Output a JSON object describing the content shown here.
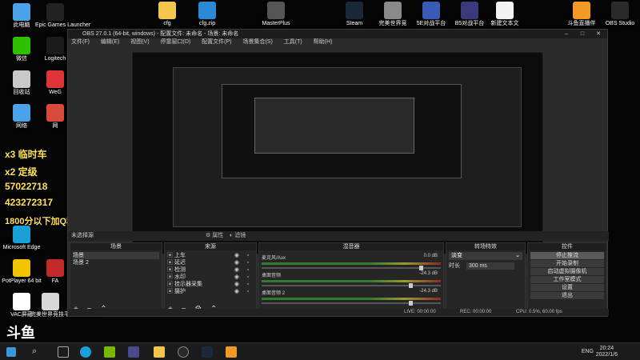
{
  "desktop": {
    "left_icons": [
      {
        "label": "此电脑",
        "icon": "computer-icon",
        "color": "#4aa3e8"
      },
      {
        "label": "Epic Games Launcher",
        "icon": "epic-icon",
        "color": "#222222"
      },
      {
        "label": "微信",
        "icon": "wechat-icon",
        "color": "#2dc100"
      },
      {
        "label": "Logitech",
        "icon": "logitech-icon",
        "color": "#1b1b1b"
      },
      {
        "label": "回收站",
        "icon": "recycle-bin-icon",
        "color": "#c9c9c9"
      },
      {
        "label": "WeG",
        "icon": "weg-icon",
        "color": "#e0343a"
      },
      {
        "label": "网络",
        "icon": "network-icon",
        "color": "#4aa3e8"
      },
      {
        "label": "网",
        "icon": "app-icon",
        "color": "#d94a3a"
      },
      {
        "label": "Microsoft Edge",
        "icon": "edge-icon",
        "color": "#1aa0d8"
      },
      {
        "label": "PotPlayer 64 bit",
        "icon": "potplayer-icon",
        "color": "#f2c300"
      },
      {
        "label": "FA",
        "icon": "fa-icon",
        "color": "#c02a2a"
      },
      {
        "label": "VAC屏蔽",
        "icon": "vac-icon",
        "color": "#ffffff"
      },
      {
        "label": "完美世界竞技平台",
        "icon": "perfect-world-icon",
        "color": "#d8d8d8"
      },
      {
        "label": "神器竞速模组",
        "icon": "mod-icon",
        "color": "#444444"
      }
    ],
    "top_icons": [
      {
        "label": "cfg",
        "icon": "folder-icon",
        "color": "#f4c64b"
      },
      {
        "label": "cfg.zip",
        "icon": "zip-icon",
        "color": "#2a8ad8"
      },
      {
        "label": "MasterPlus",
        "icon": "masterplus-icon",
        "color": "#555555"
      },
      {
        "label": "Steam",
        "icon": "steam-icon",
        "color": "#1b2838"
      },
      {
        "label": "完美世界竞",
        "icon": "perfect-icon",
        "color": "#8a8a8a"
      },
      {
        "label": "5E对战平台",
        "icon": "5e-icon",
        "color": "#3a5ab8"
      },
      {
        "label": "B5对战平台",
        "icon": "b5-icon",
        "color": "#3a3a7a"
      },
      {
        "label": "新建文本文",
        "icon": "text-file-icon",
        "color": "#f2f2f2"
      },
      {
        "label": "斗鱼直播伴",
        "icon": "douyu-icon",
        "color": "#f39a26"
      },
      {
        "label": "OBS Studio",
        "icon": "obs-icon",
        "color": "#2a2a2a"
      }
    ],
    "overlay_lines": [
      {
        "text": "x3 临时车"
      },
      {
        "text": "x2 定级"
      },
      {
        "text": "57022718"
      },
      {
        "text": "423272317"
      },
      {
        "text": "1800分以下加Q群有机会免费上分"
      }
    ],
    "watermark": "斗鱼"
  },
  "obs": {
    "title": "OBS 27.0.1 (64-bit, windows) - 配置文件: 未命名 - 场景: 未命名",
    "menu": [
      "文件(F)",
      "编辑(E)",
      "视图(V)",
      "停靠窗口(D)",
      "配置文件(P)",
      "场景集合(S)",
      "工具(T)",
      "帮助(H)"
    ],
    "scene_bar": {
      "label": "未选择源",
      "properties": "属性",
      "filters": "滤镜"
    },
    "docks": {
      "scenes": {
        "title": "场景",
        "items": [
          "场景",
          "场景 2"
        ]
      },
      "sources": {
        "title": "来源",
        "items": [
          "上车",
          "延迟",
          "检测",
          "水印",
          "挂示器采集",
          "摄护"
        ]
      },
      "mixer": {
        "title": "混音器",
        "tracks": [
          {
            "name": "麦克风/Aux",
            "db": "0.0 dB"
          },
          {
            "name": "桌面音频",
            "db": "-24.3 dB"
          },
          {
            "name": "桌面音频 2",
            "db": "-24.3 dB"
          }
        ]
      },
      "transitions": {
        "title": "转场特效",
        "value": "淡变",
        "duration_label": "时长",
        "duration": "300 ms"
      },
      "controls": {
        "title": "控件",
        "buttons": [
          "停止推流",
          "开始录制",
          "启动虚拟摄像机",
          "工作室模式",
          "设置",
          "退出"
        ]
      }
    },
    "status": {
      "live": "LIVE: 00:00:00",
      "rec": "REC: 00:00:00",
      "cpu": "CPU: 0.5%, 60.00 fps"
    }
  },
  "taskbar": {
    "lang": "ENG",
    "time": "20:24",
    "date": "2022/1/6"
  }
}
